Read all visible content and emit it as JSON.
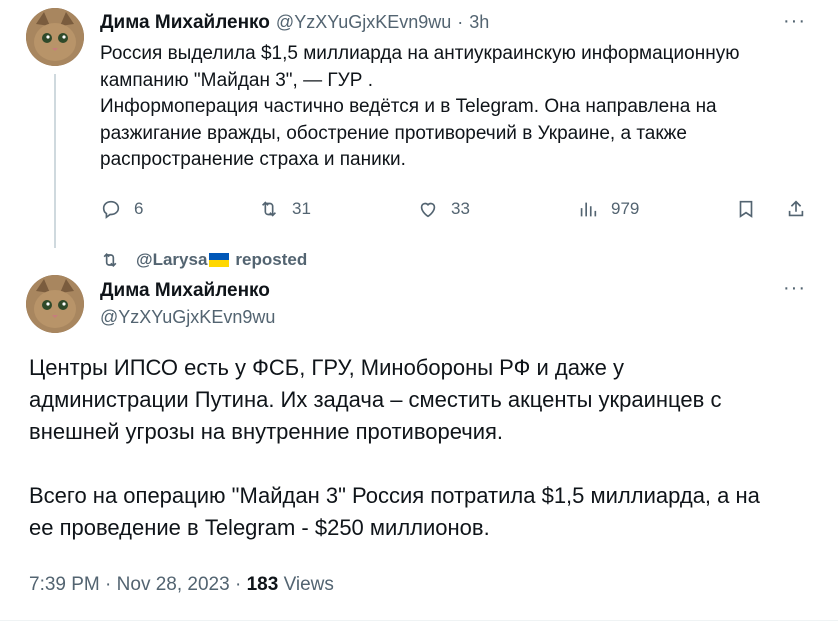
{
  "tweet1": {
    "author_name": "Дима Михайленко",
    "handle": "@YzXYuGjxKEvn9wu",
    "separator": "·",
    "time": "3h",
    "more": "···",
    "text_lines": [
      "Россия выделила $1,5 миллиарда на антиукраинскую информационную",
      "кампанию \"Майдан 3\", — ГУР .",
      "Информоперация частично ведётся и в Telegram. Она направлена на",
      "разжигание вражды, обострение противоречий в Украине, а также",
      "распространение страха и паники."
    ],
    "actions": {
      "replies": "6",
      "reposts": "31",
      "likes": "33",
      "views": "979"
    }
  },
  "repost_banner": {
    "user": "@Larysa",
    "label": "reposted"
  },
  "tweet2": {
    "author_name": "Дима Михайленко",
    "handle": "@YzXYuGjxKEvn9wu",
    "more": "···",
    "text_lines": [
      "Центры ИПСО есть у ФСБ, ГРУ, Минобороны РФ и даже у",
      "администрации Путина. Их задача – сместить акценты украинцев с",
      "внешней угрозы на внутренние противоречия.",
      "",
      "Всего на операцию \"Майдан 3\" Россия потратила $1,5 миллиарда, а на",
      "ее проведение в Telegram - $250 миллионов."
    ],
    "time": "7:39 PM",
    "sep": "·",
    "date": "Nov 28, 2023",
    "views_count": "183",
    "views_label": "Views"
  },
  "icons": [
    "reply-icon",
    "repost-icon",
    "like-icon",
    "views-icon",
    "bookmark-icon",
    "share-icon",
    "more-icon"
  ],
  "colors": {
    "text": "#0f1419",
    "secondary": "#536471",
    "line": "#cfd9de"
  }
}
